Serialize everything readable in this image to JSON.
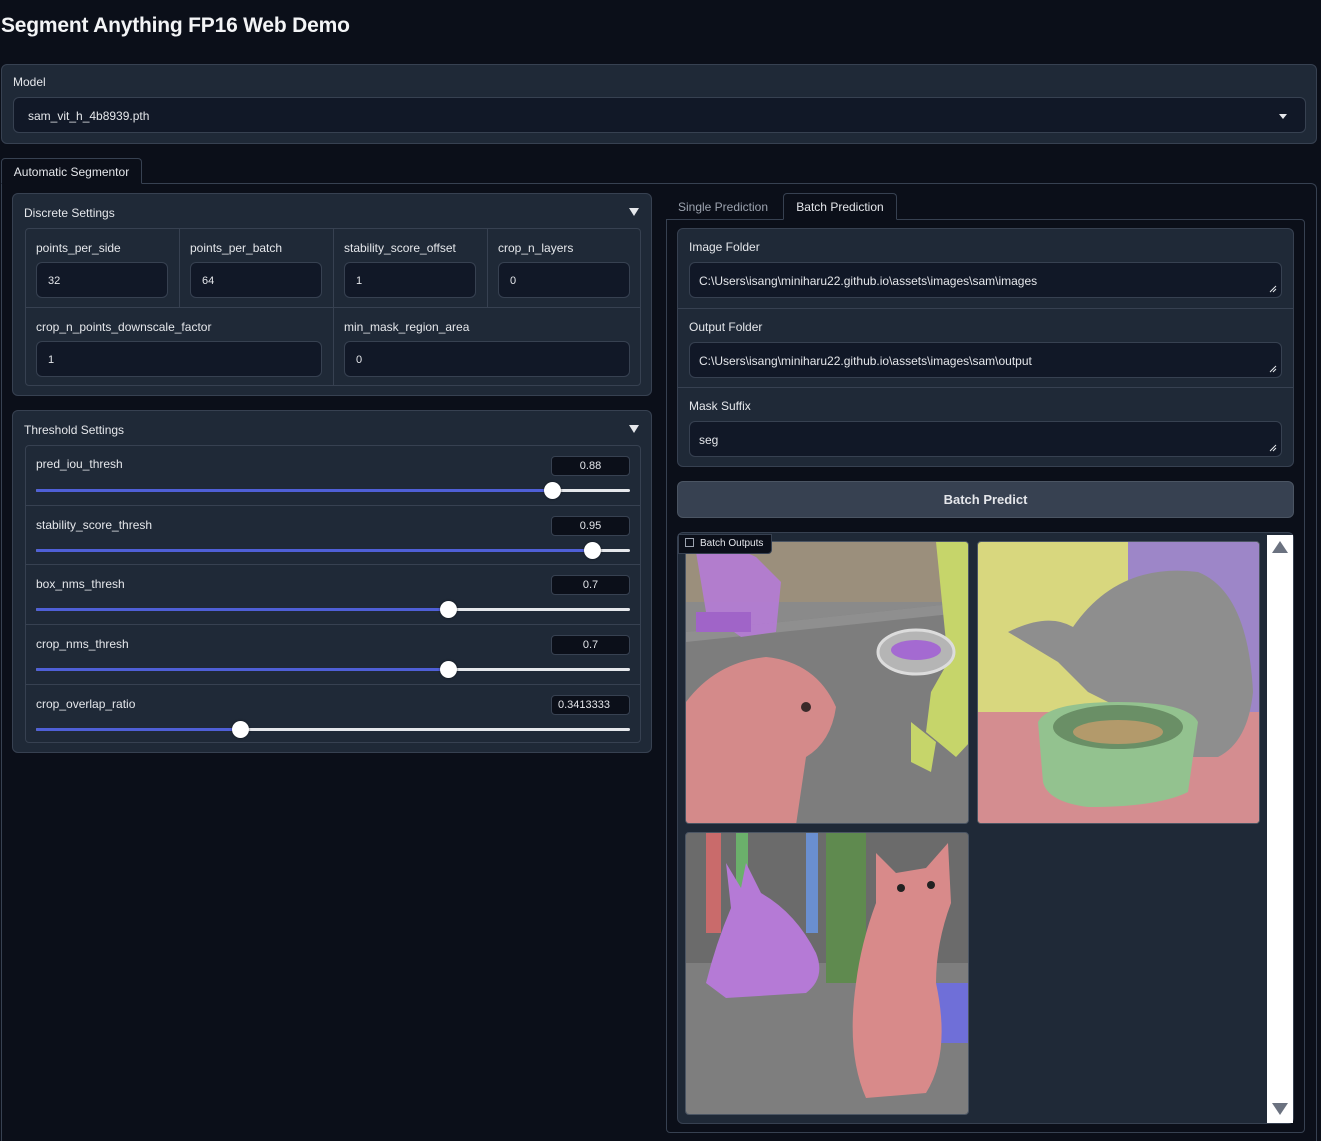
{
  "app": {
    "title": "Segment Anything FP16 Web Demo"
  },
  "model": {
    "label": "Model",
    "selected": "sam_vit_h_4b8939.pth"
  },
  "tabs": {
    "automatic": "Automatic Segmentor"
  },
  "discrete": {
    "title": "Discrete Settings",
    "fields": [
      {
        "label": "points_per_side",
        "value": "32"
      },
      {
        "label": "points_per_batch",
        "value": "64"
      },
      {
        "label": "stability_score_offset",
        "value": "1"
      },
      {
        "label": "crop_n_layers",
        "value": "0"
      },
      {
        "label": "crop_n_points_downscale_factor",
        "value": "1"
      },
      {
        "label": "min_mask_region_area",
        "value": "0"
      }
    ]
  },
  "threshold": {
    "title": "Threshold Settings",
    "sliders": [
      {
        "label": "pred_iou_thresh",
        "value": "0.88",
        "fraction": 0.868
      },
      {
        "label": "stability_score_thresh",
        "value": "0.95",
        "fraction": 0.936
      },
      {
        "label": "box_nms_thresh",
        "value": "0.7",
        "fraction": 0.694
      },
      {
        "label": "crop_nms_thresh",
        "value": "0.7",
        "fraction": 0.694
      },
      {
        "label": "crop_overlap_ratio",
        "value": "0.3413333",
        "fraction": 0.343
      }
    ]
  },
  "prediction_tabs": {
    "single": "Single Prediction",
    "batch": "Batch Prediction"
  },
  "batch": {
    "image_folder_label": "Image Folder",
    "image_folder_value": "C:\\Users\\isang\\miniharu22.github.io\\assets\\images\\sam\\images",
    "output_folder_label": "Output Folder",
    "output_folder_value": "C:\\Users\\isang\\miniharu22.github.io\\assets\\images\\sam\\output",
    "mask_suffix_label": "Mask Suffix",
    "mask_suffix_value": "seg",
    "predict_button": "Batch Predict",
    "gallery_label": "Batch Outputs"
  },
  "colors": {
    "background": "#0b0f19",
    "panel": "#1f2937",
    "border": "#374151",
    "slider_accent": "#4f5fd6"
  },
  "icons": [
    "chevron-down-icon",
    "triangle-collapse-icon",
    "resize-grip-icon",
    "image-icon",
    "scroll-up-icon",
    "scroll-down-icon"
  ]
}
